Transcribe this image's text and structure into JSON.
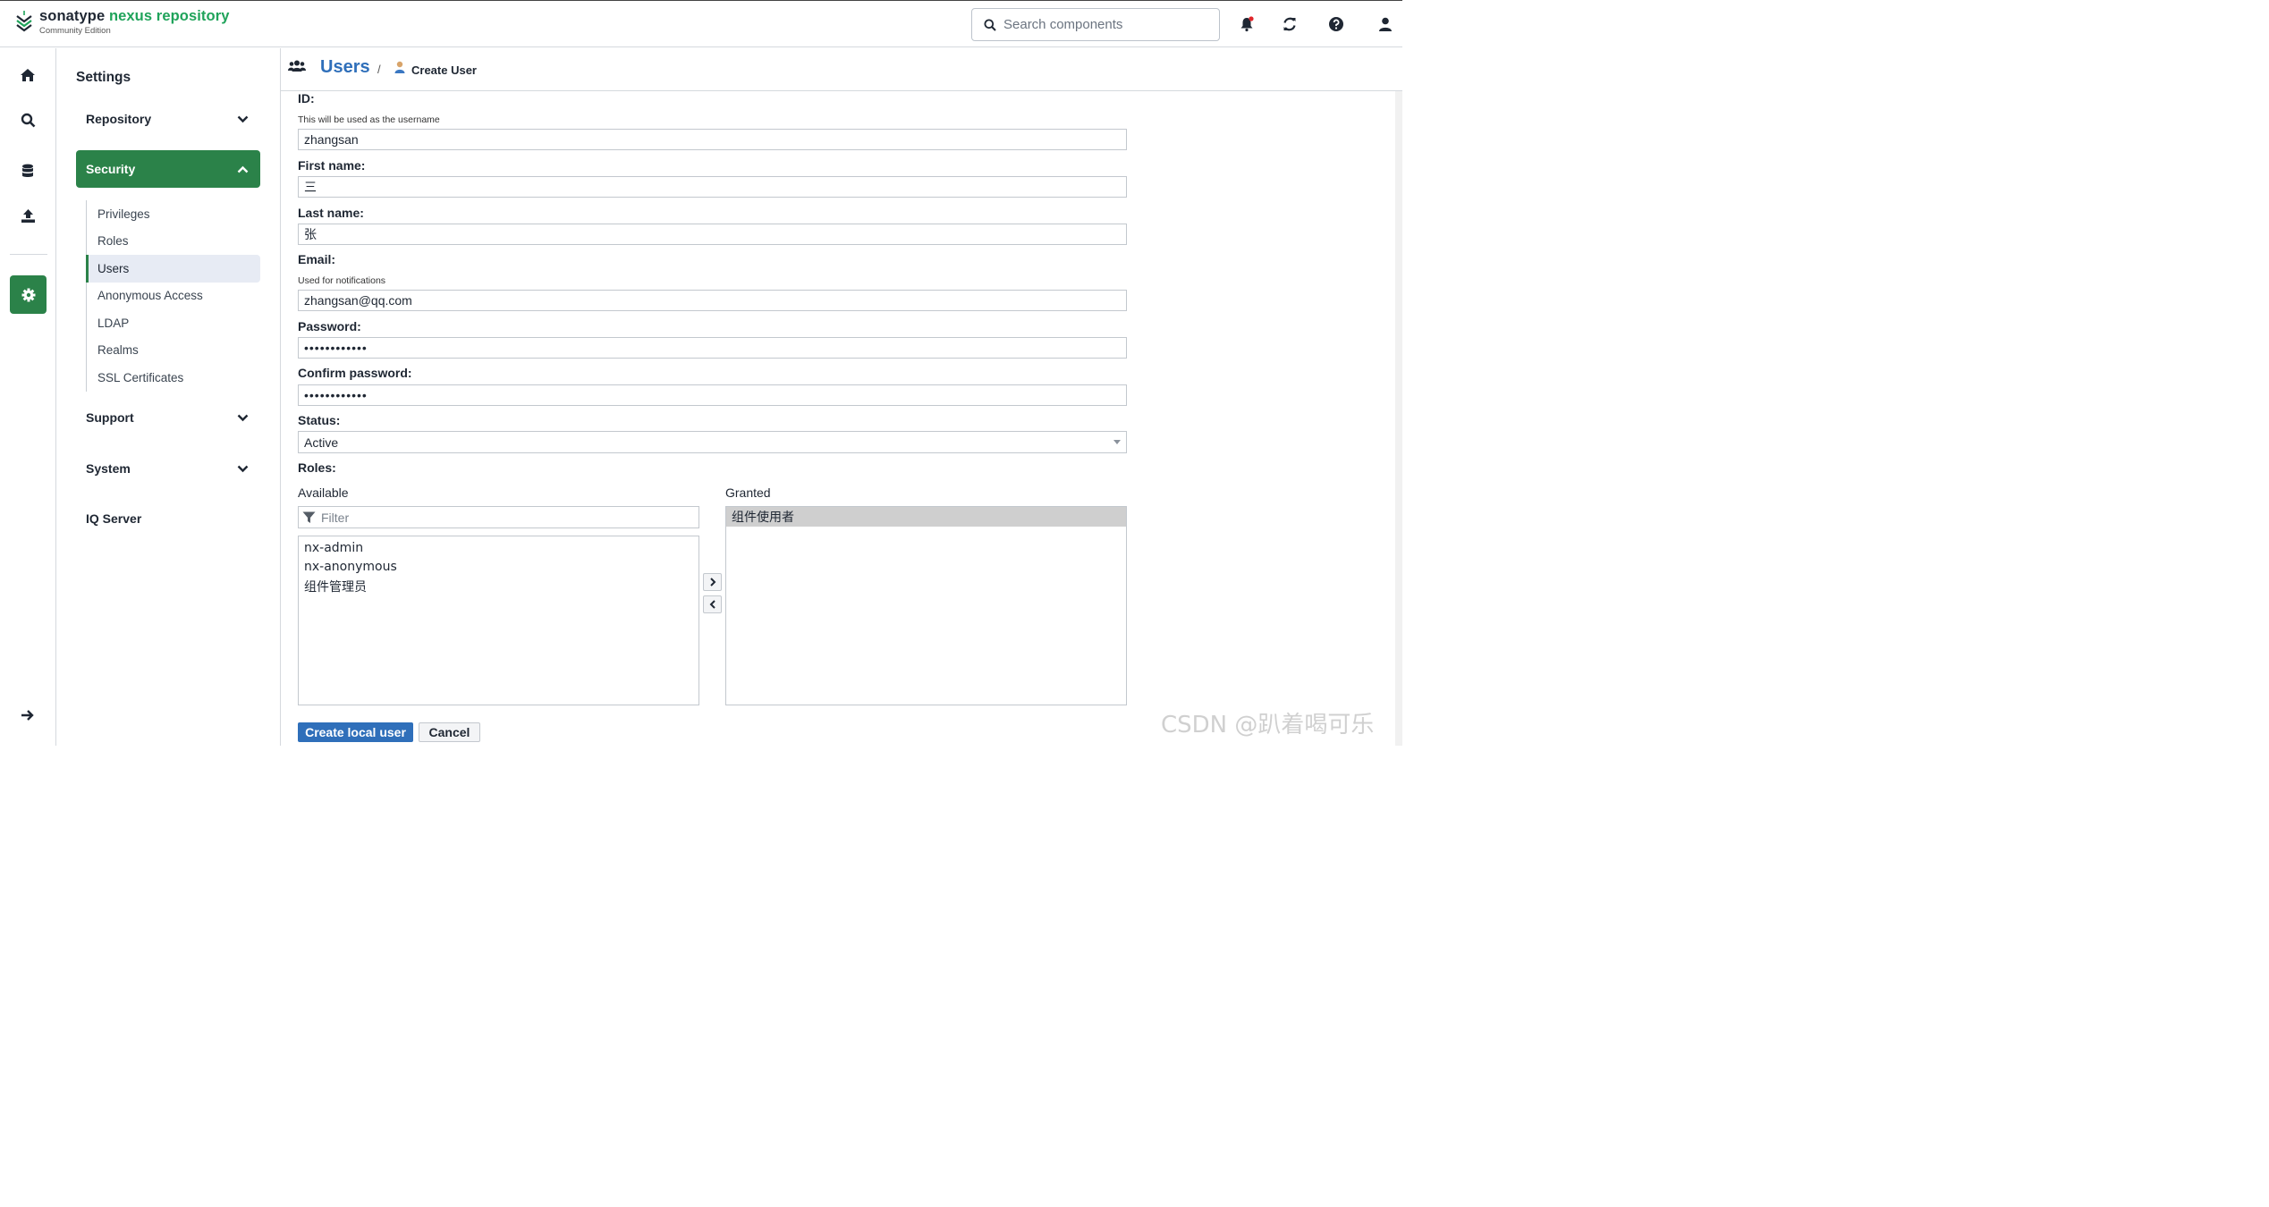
{
  "brand": {
    "name_part1": "sonatype",
    "name_part2": "nexus repository",
    "edition": "Community Edition"
  },
  "search": {
    "placeholder": "Search components"
  },
  "sidebar": {
    "title": "Settings",
    "groups": [
      {
        "label": "Repository",
        "expanded": false
      },
      {
        "label": "Security",
        "expanded": true
      },
      {
        "label": "Support",
        "expanded": false
      },
      {
        "label": "System",
        "expanded": false
      },
      {
        "label": "IQ Server"
      }
    ],
    "security_items": [
      {
        "label": "Privileges"
      },
      {
        "label": "Roles"
      },
      {
        "label": "Users",
        "active": true
      },
      {
        "label": "Anonymous Access"
      },
      {
        "label": "LDAP"
      },
      {
        "label": "Realms"
      },
      {
        "label": "SSL Certificates"
      }
    ]
  },
  "header": {
    "title": "Users",
    "separator": "/",
    "subtitle": "Create User"
  },
  "form": {
    "id_label": "ID:",
    "id_hint": "This will be used as the username",
    "id_value": "zhangsan",
    "first_name_label": "First name:",
    "first_name_value": "三",
    "last_name_label": "Last name:",
    "last_name_value": "张",
    "email_label": "Email:",
    "email_hint": "Used for notifications",
    "email_value": "zhangsan@qq.com",
    "password_label": "Password:",
    "password_value": "••••••••••••",
    "confirm_label": "Confirm password:",
    "confirm_value": "••••••••••••",
    "status_label": "Status:",
    "status_value": "Active",
    "roles_label": "Roles:",
    "available_label": "Available",
    "granted_label": "Granted",
    "filter_placeholder": "Filter",
    "available_roles": [
      "nx-admin",
      "nx-anonymous",
      "组件管理员"
    ],
    "granted_roles": [
      "组件使用者"
    ],
    "create_button": "Create local user",
    "cancel_button": "Cancel"
  },
  "watermark": "CSDN @趴着喝可乐",
  "colors": {
    "accent_green": "#2b8249",
    "brand_green": "#1fa35a",
    "link_blue": "#2f6fba",
    "notification_dot": "#e0262b"
  }
}
